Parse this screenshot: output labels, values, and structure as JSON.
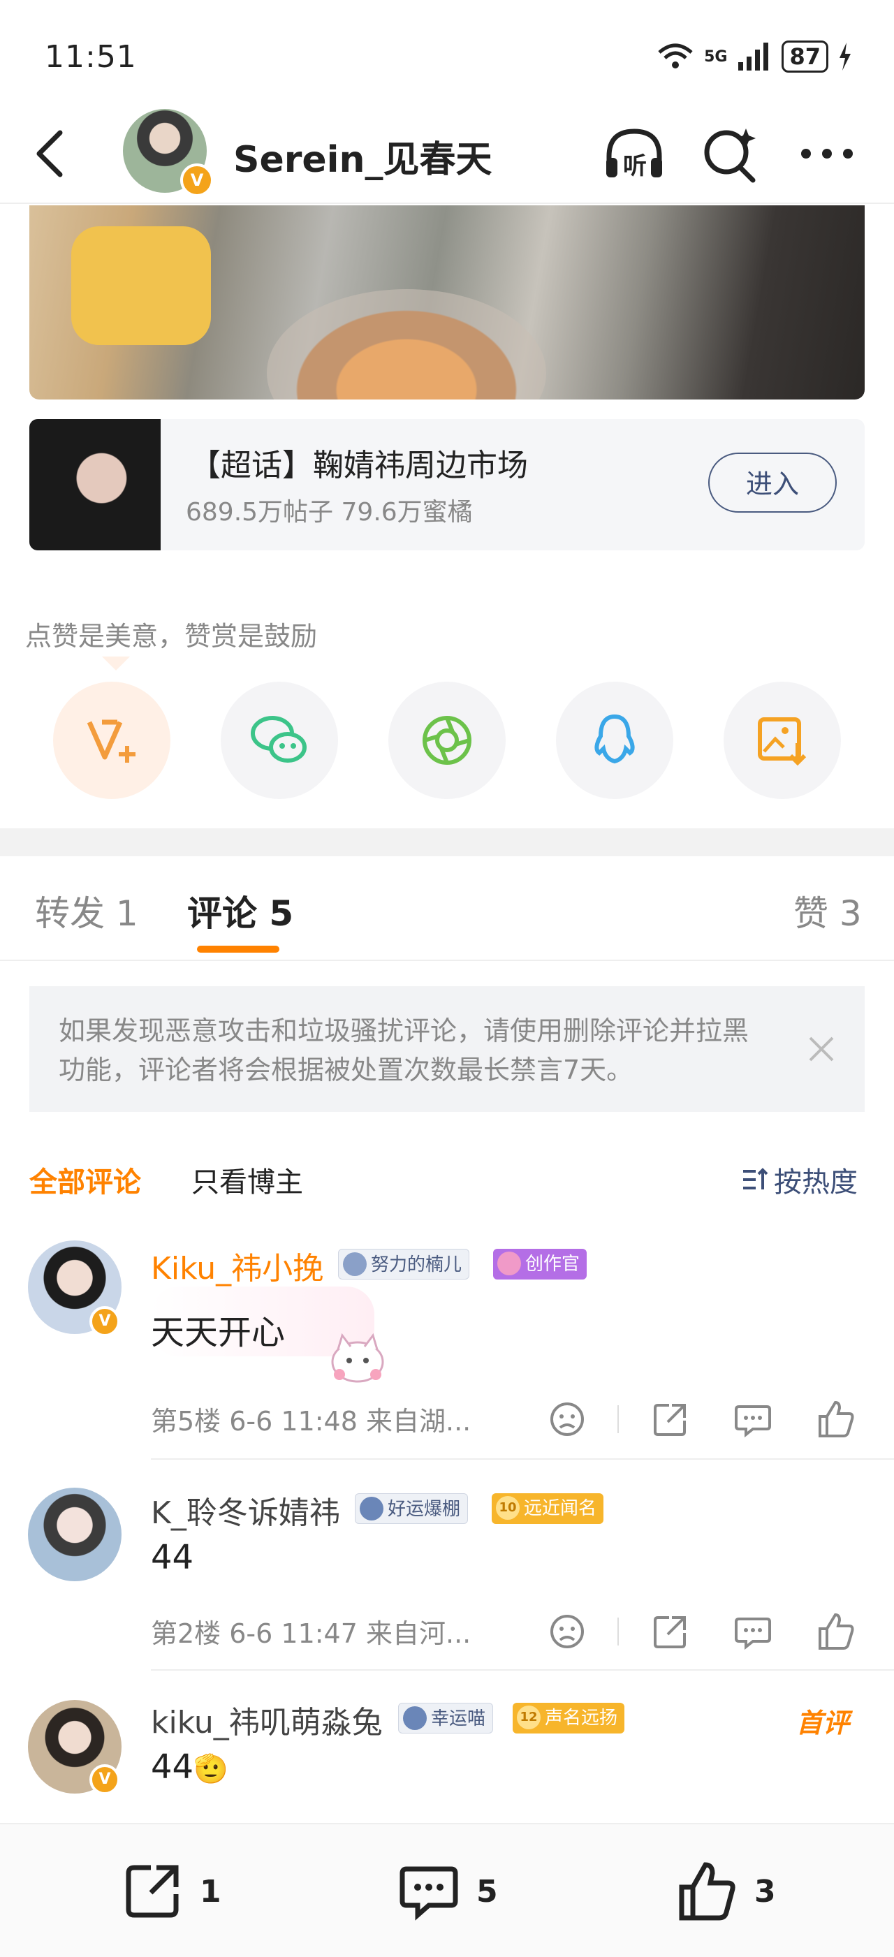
{
  "status_bar": {
    "time": "11:51",
    "network": "5G",
    "battery": "87"
  },
  "header": {
    "title": "Serein_见春天",
    "verified_badge": "V",
    "listen_label": "听"
  },
  "topic_card": {
    "title": "【超话】鞠婧祎周边市场",
    "subtitle": "689.5万帖子 79.6万蜜橘",
    "enter_label": "进入"
  },
  "share": {
    "reward_text": "点赞是美意，赞赏是鼓励",
    "buttons": [
      {
        "icon": "reward-v-icon",
        "color": "#f39c3c"
      },
      {
        "icon": "wechat-icon",
        "color": "#3cc489"
      },
      {
        "icon": "moments-icon",
        "color": "#6cc24a"
      },
      {
        "icon": "qq-icon",
        "color": "#3aa7e8"
      },
      {
        "icon": "save-image-icon",
        "color": "#f5a223"
      }
    ]
  },
  "tabs": [
    {
      "label": "转发 1"
    },
    {
      "label": "评论 5"
    },
    {
      "label": "赞 3"
    }
  ],
  "notice": {
    "text": "如果发现恶意攻击和垃圾骚扰评论，请使用删除评论并拉黑功能，评论者将会根据被处置次数最长禁言7天。"
  },
  "filters": {
    "all": "全部评论",
    "blogger_only": "只看博主",
    "sort": "按热度"
  },
  "comments": [
    {
      "name": "Kiku_祎小挽",
      "name_color": "#ff8200",
      "tags": [
        {
          "text": "努力的楠儿",
          "style": "blue"
        },
        {
          "text": "创作官",
          "style": "purple"
        }
      ],
      "text": "天天开心",
      "meta": "第5楼 6-6 11:48 来自湖...",
      "verified": true
    },
    {
      "name": "K_聆冬诉婧祎",
      "name_color": "#444444",
      "tags": [
        {
          "text": "好运爆棚",
          "style": "blue"
        },
        {
          "text": "远近闻名",
          "style": "gold",
          "level": "10"
        }
      ],
      "text": "44",
      "meta": "第2楼 6-6 11:47 来自河...",
      "verified": false
    },
    {
      "name": "kiku_祎叽萌淼兔",
      "name_color": "#444444",
      "tags": [
        {
          "text": "幸运喵",
          "style": "blue"
        },
        {
          "text": "声名远扬",
          "style": "gold",
          "level": "12"
        }
      ],
      "text": "44",
      "emoji": "🫡",
      "badge": "首评",
      "verified": true
    }
  ],
  "bottom_bar": {
    "repost_count": "1",
    "comment_count": "5",
    "like_count": "3"
  }
}
